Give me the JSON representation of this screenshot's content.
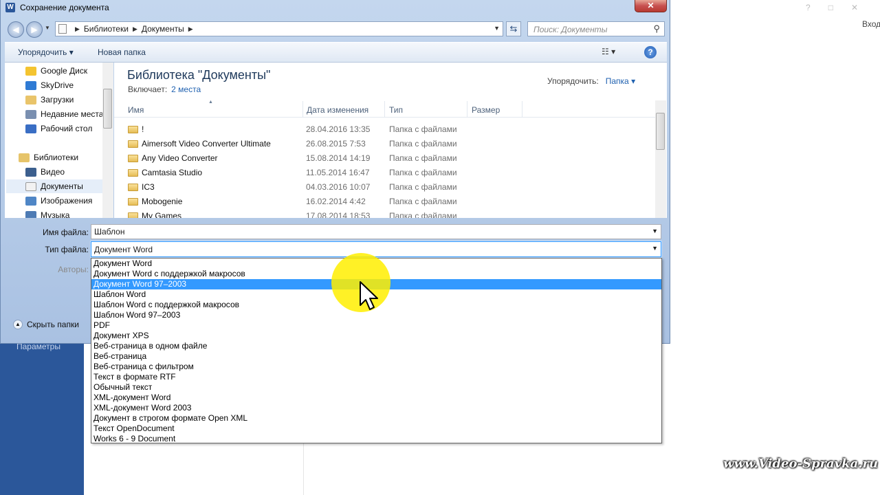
{
  "background": {
    "params_label": "Параметры",
    "window_btn_min": "?",
    "window_btn_restore": "□",
    "window_btn_close": "✕",
    "login_label": "Вход",
    "watermark": "www.Video-Spravka.ru"
  },
  "dialog": {
    "title": "Сохранение документа",
    "close_glyph": "✕",
    "word_icon": "W",
    "nav": {
      "back_glyph": "◀",
      "forward_glyph": "▶",
      "breadcrumb": [
        "Библиотеки",
        "Документы"
      ],
      "search_placeholder": "Поиск: Документы"
    },
    "toolbar": {
      "organize_label": "Упорядочить ▾",
      "new_folder_label": "Новая папка",
      "view_label": "☷ ▾",
      "help_label": "?"
    },
    "navpane": {
      "items": [
        {
          "label": "Google Диск",
          "icon": "google-drive-icon",
          "color": "#f4c430"
        },
        {
          "label": "SkyDrive",
          "icon": "skydrive-icon",
          "color": "#2f7bd4"
        },
        {
          "label": "Загрузки",
          "icon": "downloads-icon",
          "color": "#e9c46a"
        },
        {
          "label": "Недавние места",
          "icon": "recent-places-icon",
          "color": "#7a8fb0"
        },
        {
          "label": "Рабочий стол",
          "icon": "desktop-icon",
          "color": "#3a6ec4"
        },
        {
          "label": "Библиотеки",
          "icon": "libraries-icon",
          "color": "#e6c46a"
        },
        {
          "label": "Видео",
          "icon": "video-icon",
          "color": "#3c5f8e"
        },
        {
          "label": "Документы",
          "icon": "documents-icon",
          "color": "#f2f2f2"
        },
        {
          "label": "Изображения",
          "icon": "pictures-icon",
          "color": "#4f86c6"
        },
        {
          "label": "Музыка",
          "icon": "music-icon",
          "color": "#4e7bb4"
        }
      ]
    },
    "library": {
      "title": "Библиотека \"Документы\"",
      "includes_label": "Включает:",
      "includes_link": "2 места",
      "arrange_label": "Упорядочить:",
      "arrange_value": "Папка ▾"
    },
    "columns": {
      "name": "Имя",
      "date": "Дата изменения",
      "type": "Тип",
      "size": "Размер"
    },
    "files": [
      {
        "name": "!",
        "date": "28.04.2016 13:35",
        "type": "Папка с файлами"
      },
      {
        "name": "Aimersoft Video Converter Ultimate",
        "date": "26.08.2015 7:53",
        "type": "Папка с файлами"
      },
      {
        "name": "Any Video Converter",
        "date": "15.08.2014 14:19",
        "type": "Папка с файлами"
      },
      {
        "name": "Camtasia Studio",
        "date": "11.05.2014 16:47",
        "type": "Папка с файлами"
      },
      {
        "name": "IC3",
        "date": "04.03.2016 10:07",
        "type": "Папка с файлами"
      },
      {
        "name": "Mobogenie",
        "date": "16.02.2014 4:42",
        "type": "Папка с файлами"
      },
      {
        "name": "My Games",
        "date": "17.08.2014 18:53",
        "type": "Папка с файлами"
      }
    ],
    "filename_label": "Имя файла:",
    "filename_value": "Шаблон",
    "filetype_label": "Тип файла:",
    "filetype_value": "Документ Word",
    "authors_label": "Авторы:",
    "hide_folders_label": "Скрыть папки",
    "filetype_options": [
      "Документ Word",
      "Документ Word с поддержкой макросов",
      "Документ Word 97–2003",
      "Шаблон Word",
      "Шаблон Word с поддержкой макросов",
      "Шаблон Word 97–2003",
      "PDF",
      "Документ XPS",
      "Веб-страница в одном файле",
      "Веб-страница",
      "Веб-страница с фильтром",
      "Текст в формате RTF",
      "Обычный текст",
      "XML-документ Word",
      "XML-документ Word 2003",
      "Документ в строгом формате Open XML",
      "Текст OpenDocument",
      "Works 6 - 9 Document"
    ],
    "highlighted_option_index": 2
  },
  "colors": {
    "accent": "#3399ff",
    "word_blue": "#2b579a",
    "title_blue": "#1e395b",
    "link_blue": "#1f61b0",
    "cursor_highlight": "#ffee00"
  }
}
